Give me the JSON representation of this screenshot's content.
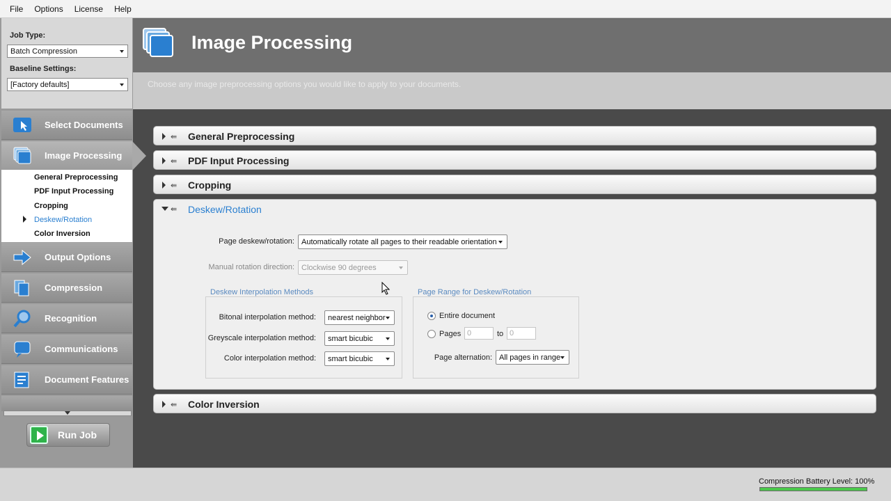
{
  "menubar": {
    "items": [
      "File",
      "Options",
      "License",
      "Help"
    ]
  },
  "sidebar": {
    "job_type_label": "Job Type:",
    "job_type_value": "Batch Compression",
    "baseline_label": "Baseline Settings:",
    "baseline_value": "[Factory defaults]",
    "nav": [
      {
        "label": "Select Documents",
        "icon": "cursor-select-icon"
      },
      {
        "label": "Image Processing",
        "icon": "image-stack-icon"
      },
      {
        "label": "Output Options",
        "icon": "arrow-out-icon"
      },
      {
        "label": "Compression",
        "icon": "compression-icon"
      },
      {
        "label": "Recognition",
        "icon": "magnifier-icon"
      },
      {
        "label": "Communications",
        "icon": "speech-bubble-icon"
      },
      {
        "label": "Document Features",
        "icon": "document-features-icon"
      }
    ],
    "sub_items": [
      "General Preprocessing",
      "PDF Input Processing",
      "Cropping",
      "Deskew/Rotation",
      "Color Inversion"
    ],
    "run_job": "Run Job"
  },
  "header": {
    "title": "Image Processing",
    "description": "Choose any image preprocessing options you would like to apply to your documents."
  },
  "sections": [
    "General Preprocessing",
    "PDF Input Processing",
    "Cropping",
    "Deskew/Rotation",
    "Color Inversion"
  ],
  "deskew": {
    "page_deskew_label": "Page deskew/rotation:",
    "page_deskew_value": "Automatically rotate all pages to their readable orientation",
    "manual_rotation_label": "Manual rotation direction:",
    "manual_rotation_value": "Clockwise 90 degrees",
    "interp_group": "Deskew Interpolation Methods",
    "bitonal_label": "Bitonal interpolation method:",
    "bitonal_value": "nearest neighbor",
    "greyscale_label": "Greyscale interpolation method:",
    "greyscale_value": "smart bicubic",
    "color_label": "Color interpolation method:",
    "color_value": "smart bicubic",
    "range_group": "Page Range for Deskew/Rotation",
    "entire_doc": "Entire document",
    "pages_label": "Pages",
    "page_from": "0",
    "to_label": "to",
    "page_to": "0",
    "alternation_label": "Page alternation:",
    "alternation_value": "All pages in range"
  },
  "status": {
    "battery_label": "Compression Battery Level:  100%",
    "battery_level": 1.0
  }
}
